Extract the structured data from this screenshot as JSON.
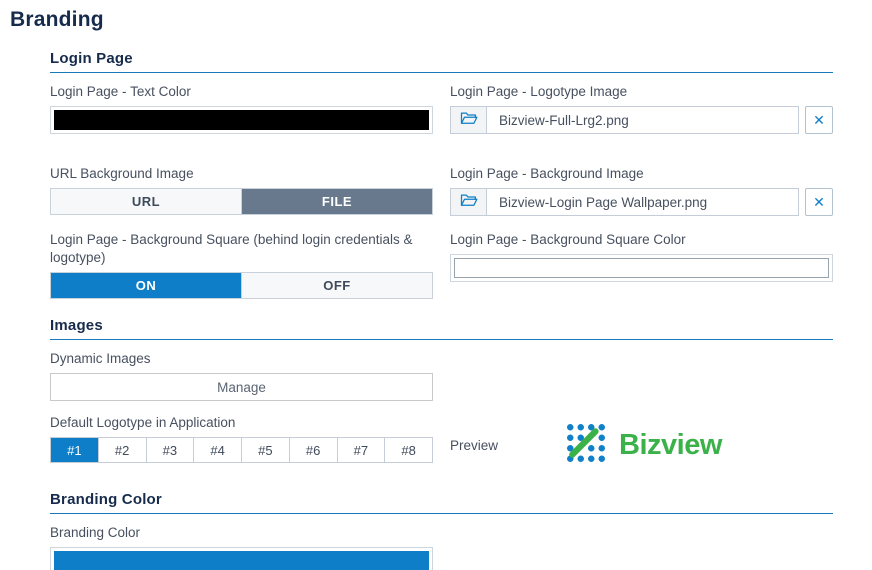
{
  "page": {
    "title": "Branding"
  },
  "colors": {
    "primary_blue": "#0d7ec7",
    "active_slate": "#68798e",
    "header_navy": "#172b4d",
    "rule_blue": "#1779ba",
    "logo_green": "#3bb14a",
    "logo_dot_blue": "#1080c8"
  },
  "login_page": {
    "title": "Login Page",
    "text_color": {
      "label": "Login Page - Text Color",
      "value": "#000000"
    },
    "logotype_image": {
      "label": "Login Page - Logotype Image",
      "filename": "Bizview-Full-Lrg2.png",
      "clear_glyph": "✕"
    },
    "url_background_image": {
      "label": "URL Background Image",
      "options": [
        "URL",
        "FILE"
      ],
      "selected": "FILE"
    },
    "background_image": {
      "label": "Login Page - Background Image",
      "filename": "Bizview-Login Page Wallpaper.png",
      "clear_glyph": "✕"
    },
    "background_square": {
      "label": "Login Page - Background Square (behind login credentials & logotype)",
      "options": [
        "ON",
        "OFF"
      ],
      "selected": "ON"
    },
    "background_square_color": {
      "label": "Login Page - Background Square Color",
      "value": ""
    }
  },
  "images": {
    "title": "Images",
    "dynamic_images": {
      "label": "Dynamic Images",
      "button_label": "Manage"
    },
    "default_logotype": {
      "label": "Default Logotype in Application",
      "options": [
        "#1",
        "#2",
        "#3",
        "#4",
        "#5",
        "#6",
        "#7",
        "#8"
      ],
      "selected": "#1"
    },
    "preview": {
      "label": "Preview",
      "logo_text": "Bizview"
    }
  },
  "branding": {
    "title": "Branding Color",
    "branding_color": {
      "label": "Branding Color",
      "value": "#0d7ec7"
    }
  }
}
